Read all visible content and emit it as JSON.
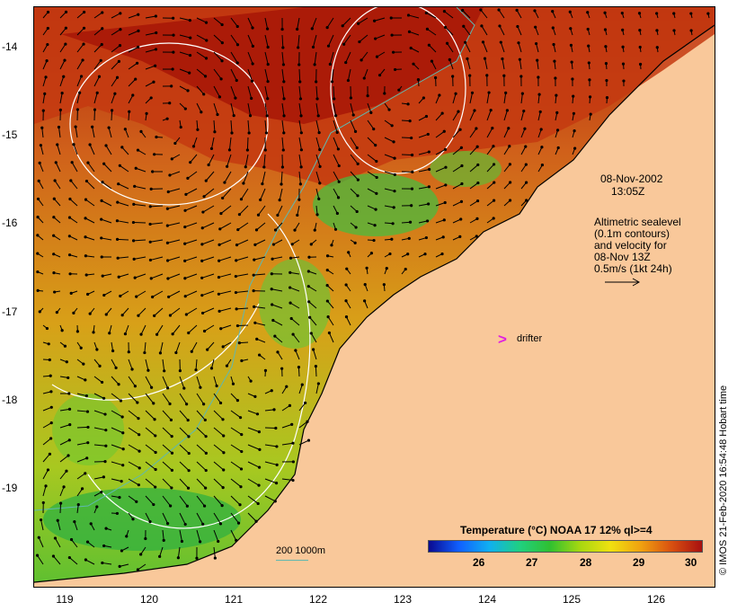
{
  "map": {
    "lat_labels": [
      "-14",
      "-15",
      "-16",
      "-17",
      "-18",
      "-19"
    ],
    "lon_labels": [
      "119",
      "120",
      "121",
      "122",
      "123",
      "124",
      "125",
      "126"
    ]
  },
  "annotations": {
    "date": "08-Nov-2002",
    "time": "13:05Z",
    "info_lines": [
      "Altimetric sealevel",
      "(0.1m contours)",
      "and velocity for",
      "08-Nov 13Z",
      "0.5m/s (1kt 24h)"
    ],
    "drifter_symbol": ">",
    "drifter_label": "drifter"
  },
  "colorbar": {
    "title": "Temperature (°C) NOAA 17 12% ql>=4",
    "ticks": [
      "26",
      "27",
      "28",
      "29",
      "30"
    ],
    "colors": [
      "#0a0a90",
      "#1060ff",
      "#10b0f0",
      "#20d080",
      "#30c030",
      "#a8d810",
      "#f0e010",
      "#f0a010",
      "#d85010",
      "#a81010"
    ]
  },
  "scale": {
    "label": "200  1000m",
    "color": "#5fb8b0"
  },
  "credit": "© IMOS 21-Feb-2020 16:54:48 Hobart time",
  "colors": {
    "land": "#f9c89a",
    "warm": "#c43a10",
    "hot": "#a81808",
    "mid": "#e08020",
    "yellow": "#e8d818",
    "green": "#40c040"
  }
}
